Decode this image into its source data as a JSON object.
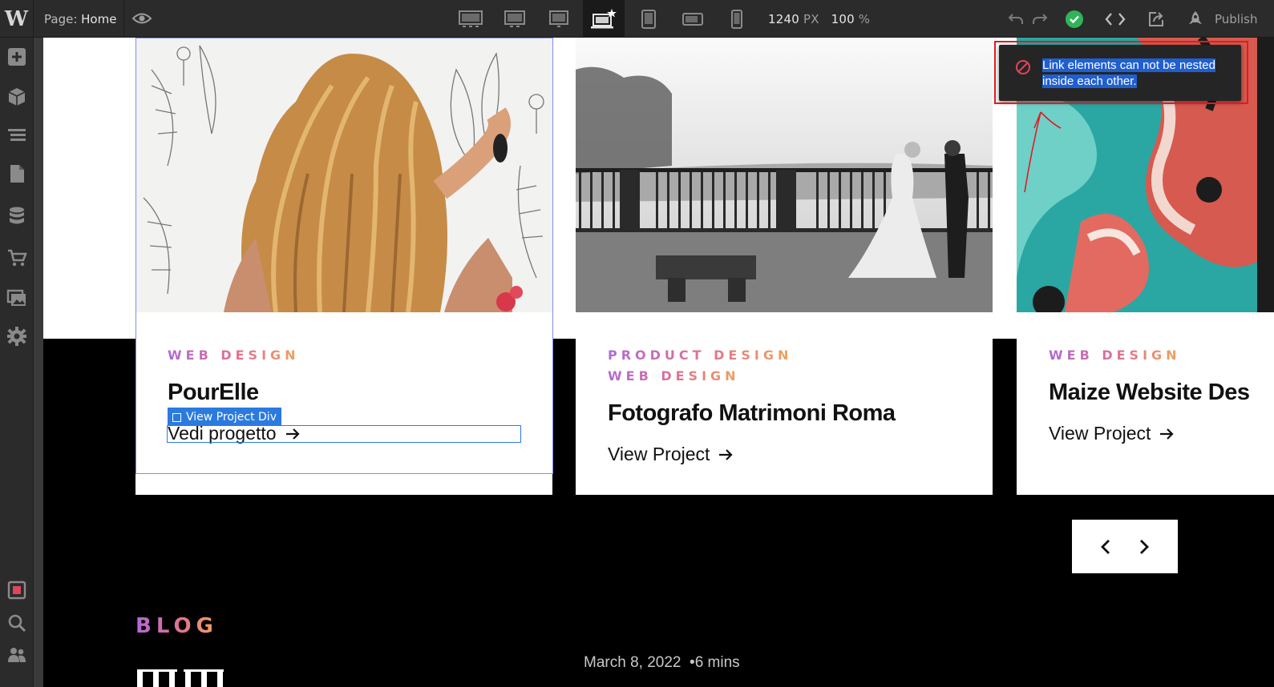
{
  "toolbar": {
    "logo": "W",
    "page_prefix": "Page:",
    "page_name": "Home",
    "width_value": "1240",
    "width_unit": "PX",
    "zoom_value": "100",
    "zoom_unit": "%",
    "publish_label": "Publish",
    "status_color": "#2fb45a"
  },
  "breakpoints": [
    "desktop-wide-icon",
    "desktop-large-icon",
    "desktop-icon",
    "desktop-base-star-icon",
    "tablet-icon",
    "mobile-landscape-icon",
    "mobile-portrait-icon"
  ],
  "sidebar": [
    "add-panel-icon",
    "symbols-icon",
    "navigator-icon",
    "pages-icon",
    "cms-icon",
    "ecommerce-icon",
    "assets-icon",
    "settings-icon",
    "audit-icon",
    "search-icon",
    "collaborators-icon"
  ],
  "cards": [
    {
      "categories": [
        "WEB DESIGN"
      ],
      "title": "PourElle",
      "link": "Vedi progetto",
      "image": "woman-long-wavy-hair-photo"
    },
    {
      "categories": [
        "PRODUCT DESIGN",
        "WEB DESIGN"
      ],
      "title": "Fotografo Matrimoni Roma",
      "link": "View Project",
      "image": "wedding-couple-terrace-photo"
    },
    {
      "categories": [
        "WEB DESIGN"
      ],
      "title": "Maize Website Des",
      "link": "View Project",
      "image": "teal-red-abstract-fluid-art"
    }
  ],
  "selection": {
    "tag_label": "View Project Div",
    "color": "#2b7ae0"
  },
  "blog": {
    "heading": "BLOG",
    "date": "March 8, 2022",
    "read_time": "6 mins"
  },
  "toast": {
    "message": "Link elements can not be nested inside each other.",
    "annotation_color": "#e11b22"
  },
  "accent_gradient": [
    "#b06ad6",
    "#e2728f",
    "#f0a45a"
  ]
}
